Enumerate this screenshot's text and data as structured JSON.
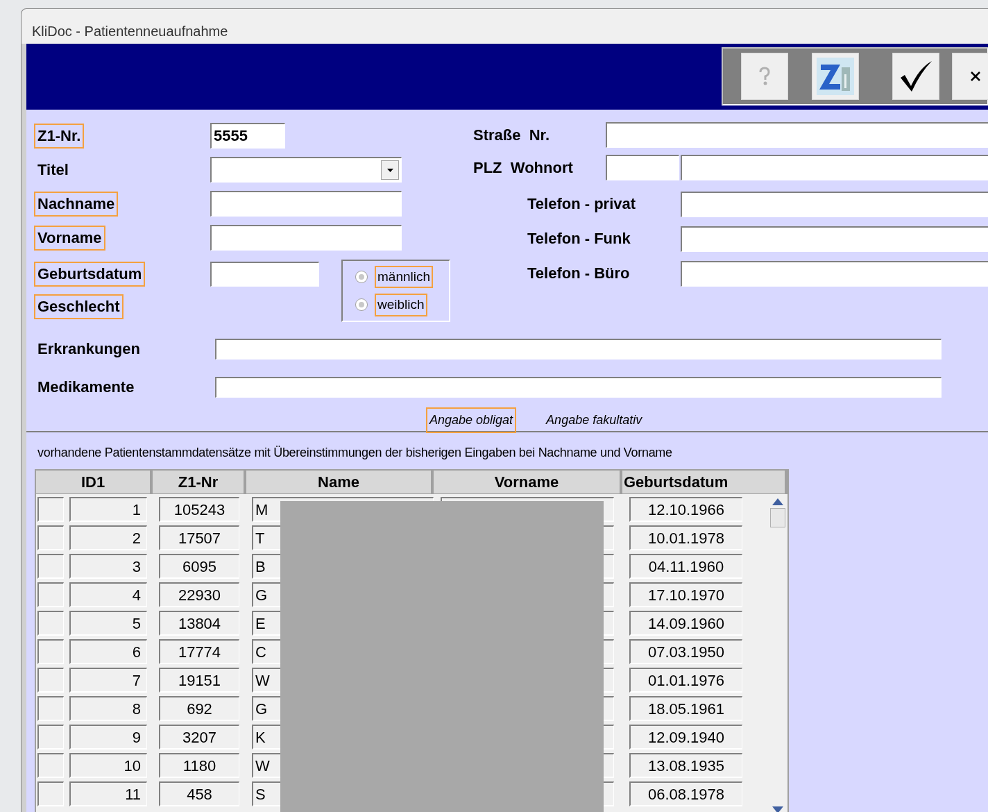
{
  "window": {
    "title": "KliDoc - Patientenneuaufnahme"
  },
  "toolbar": {
    "buttons": [
      {
        "kind": "help"
      },
      {
        "kind": "logo"
      },
      {
        "kind": "confirm"
      },
      {
        "kind": "close"
      }
    ]
  },
  "form": {
    "left_fields": [
      {
        "label": "Z1-Nr.",
        "mandatory": true,
        "kind": "text",
        "value": "5555"
      },
      {
        "label": "Titel",
        "mandatory": false,
        "kind": "select"
      },
      {
        "label": "Nachname",
        "mandatory": true,
        "kind": "text"
      },
      {
        "label": "Vorname",
        "mandatory": true,
        "kind": "text"
      }
    ],
    "birth": {
      "label": "Geburtsdatum",
      "mandatory": true
    },
    "gender": {
      "label": "Geschlecht",
      "mandatory": true,
      "options": [
        {
          "label": "männlich",
          "selected": false
        },
        {
          "label": "weiblich",
          "selected": false
        }
      ]
    },
    "address": [
      {
        "label": "Straße  Nr.",
        "kind": "single"
      },
      {
        "label": "PLZ  Wohnort",
        "kind": "split"
      }
    ],
    "phones": [
      {
        "label": "Telefon - privat"
      },
      {
        "label": "Telefon - Funk"
      },
      {
        "label": "Telefon - Büro"
      }
    ],
    "wide_fields": [
      {
        "label": "Erkrankungen"
      },
      {
        "label": "Medikamente"
      }
    ],
    "legend": [
      {
        "label": "Angabe obligat",
        "mandatory": true
      },
      {
        "label": "Angabe fakultativ",
        "mandatory": false
      }
    ]
  },
  "table": {
    "caption": "vorhandene Patientenstammdatensätze mit Übereinstimmungen der bisherigen Eingaben bei Nachname und Vorname",
    "columns": [
      "ID1",
      "Z1-Nr",
      "Name",
      "Vorname",
      "Geburtsdatum"
    ],
    "rows": [
      {
        "id": "1",
        "z1": "105243",
        "name": "M",
        "birth": "12.10.1966"
      },
      {
        "id": "2",
        "z1": "17507",
        "name": "T",
        "birth": "10.01.1978"
      },
      {
        "id": "3",
        "z1": "6095",
        "name": "B",
        "birth": "04.11.1960"
      },
      {
        "id": "4",
        "z1": "22930",
        "name": "G",
        "birth": "17.10.1970"
      },
      {
        "id": "5",
        "z1": "13804",
        "name": "E",
        "birth": "14.09.1960"
      },
      {
        "id": "6",
        "z1": "17774",
        "name": "C",
        "birth": "07.03.1950"
      },
      {
        "id": "7",
        "z1": "19151",
        "name": "W",
        "birth": "01.01.1976"
      },
      {
        "id": "8",
        "z1": "692",
        "name": "G",
        "birth": "18.05.1961"
      },
      {
        "id": "9",
        "z1": "3207",
        "name": "K",
        "birth": "12.09.1940"
      },
      {
        "id": "10",
        "z1": "1180",
        "name": "W",
        "birth": "13.08.1935"
      },
      {
        "id": "11",
        "z1": "458",
        "name": "S",
        "birth": "06.08.1978"
      }
    ]
  }
}
